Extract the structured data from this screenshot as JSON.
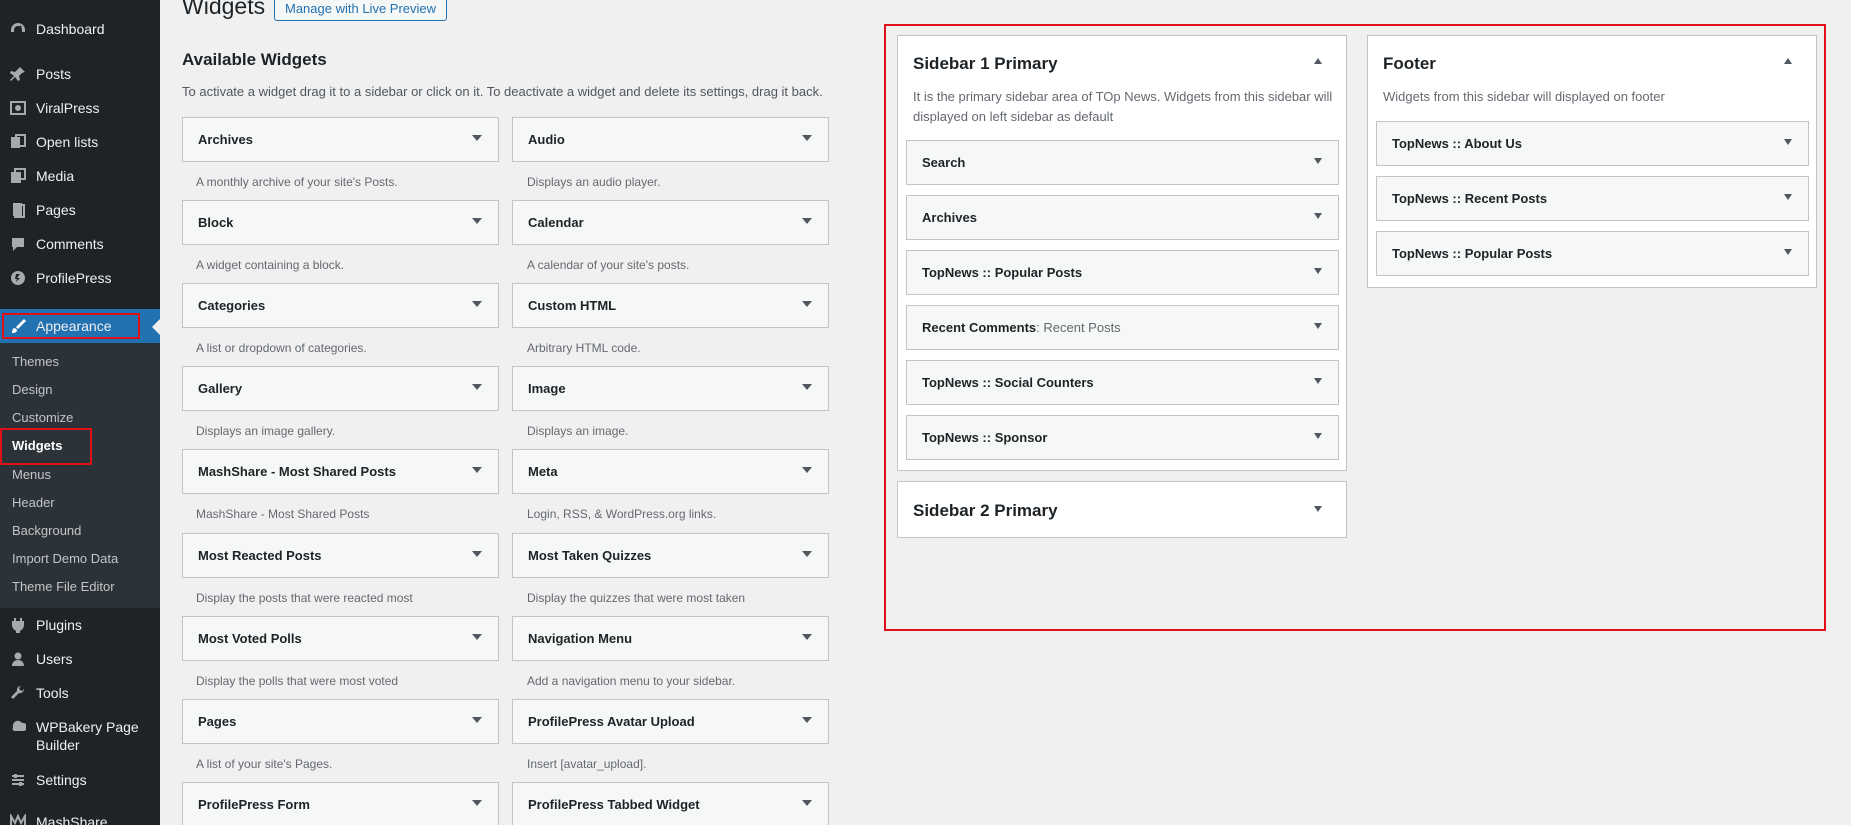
{
  "page": {
    "title": "Widgets",
    "preview_button": "Manage with Live Preview",
    "available_title": "Available Widgets",
    "available_desc": "To activate a widget drag it to a sidebar or click on it. To deactivate a widget and delete its settings, drag it back."
  },
  "menu": [
    {
      "label": "Dashboard",
      "icon": "dashboard-icon"
    },
    {
      "label": "Posts",
      "icon": "pin-icon"
    },
    {
      "label": "ViralPress",
      "icon": "image-icon"
    },
    {
      "label": "Open lists",
      "icon": "list-icon"
    },
    {
      "label": "Media",
      "icon": "media-icon"
    },
    {
      "label": "Pages",
      "icon": "page-icon"
    },
    {
      "label": "Comments",
      "icon": "comment-icon"
    },
    {
      "label": "ProfilePress",
      "icon": "profilepress-icon"
    },
    {
      "label": "Appearance",
      "icon": "brush-icon"
    },
    {
      "label": "Plugins",
      "icon": "plugin-icon"
    },
    {
      "label": "Users",
      "icon": "user-icon"
    },
    {
      "label": "Tools",
      "icon": "wrench-icon"
    },
    {
      "label": "WPBakery Page Builder",
      "icon": "wpbakery-icon"
    },
    {
      "label": "Settings",
      "icon": "settings-icon"
    },
    {
      "label": "MashShare",
      "icon": "mashshare-icon"
    }
  ],
  "submenu": [
    "Themes",
    "Design",
    "Customize",
    "Widgets",
    "Menus",
    "Header",
    "Background",
    "Import Demo Data",
    "Theme File Editor"
  ],
  "widgets": [
    {
      "title": "Archives",
      "desc": "A monthly archive of your site's Posts."
    },
    {
      "title": "Audio",
      "desc": "Displays an audio player."
    },
    {
      "title": "Block",
      "desc": "A widget containing a block."
    },
    {
      "title": "Calendar",
      "desc": "A calendar of your site's posts."
    },
    {
      "title": "Categories",
      "desc": "A list or dropdown of categories."
    },
    {
      "title": "Custom HTML",
      "desc": "Arbitrary HTML code."
    },
    {
      "title": "Gallery",
      "desc": "Displays an image gallery."
    },
    {
      "title": "Image",
      "desc": "Displays an image."
    },
    {
      "title": "MashShare - Most Shared Posts",
      "desc": "MashShare - Most Shared Posts"
    },
    {
      "title": "Meta",
      "desc": "Login, RSS, & WordPress.org links."
    },
    {
      "title": "Most Reacted Posts",
      "desc": "Display the posts that were reacted most"
    },
    {
      "title": "Most Taken Quizzes",
      "desc": "Display the quizzes that were most taken"
    },
    {
      "title": "Most Voted Polls",
      "desc": "Display the polls that were most voted"
    },
    {
      "title": "Navigation Menu",
      "desc": "Add a navigation menu to your sidebar."
    },
    {
      "title": "Pages",
      "desc": "A list of your site's Pages."
    },
    {
      "title": "ProfilePress Avatar Upload",
      "desc": "Insert [avatar_upload]."
    },
    {
      "title": "ProfilePress Form",
      "desc": ""
    },
    {
      "title": "ProfilePress Tabbed Widget",
      "desc": ""
    }
  ],
  "sidebar1": {
    "title": "Sidebar 1 Primary",
    "desc": "It is the primary sidebar area of TOp News. Widgets from this sidebar will displayed on left sidebar as default",
    "widgets": [
      {
        "title": "Search",
        "sub": ""
      },
      {
        "title": "Archives",
        "sub": ""
      },
      {
        "title": "TopNews :: Popular Posts",
        "sub": ""
      },
      {
        "title": "Recent Comments",
        "sub": ": Recent Posts"
      },
      {
        "title": "TopNews :: Social Counters",
        "sub": ""
      },
      {
        "title": "TopNews :: Sponsor",
        "sub": ""
      }
    ]
  },
  "sidebar2": {
    "title": "Sidebar 2 Primary"
  },
  "footer": {
    "title": "Footer",
    "desc": "Widgets from this sidebar will displayed on footer",
    "widgets": [
      {
        "title": "TopNews :: About Us"
      },
      {
        "title": "TopNews :: Recent Posts"
      },
      {
        "title": "TopNews :: Popular Posts"
      }
    ]
  },
  "colors": {
    "highlight": "#e0101b",
    "accent": "#2271b1",
    "menu_bg": "#1d2327"
  }
}
